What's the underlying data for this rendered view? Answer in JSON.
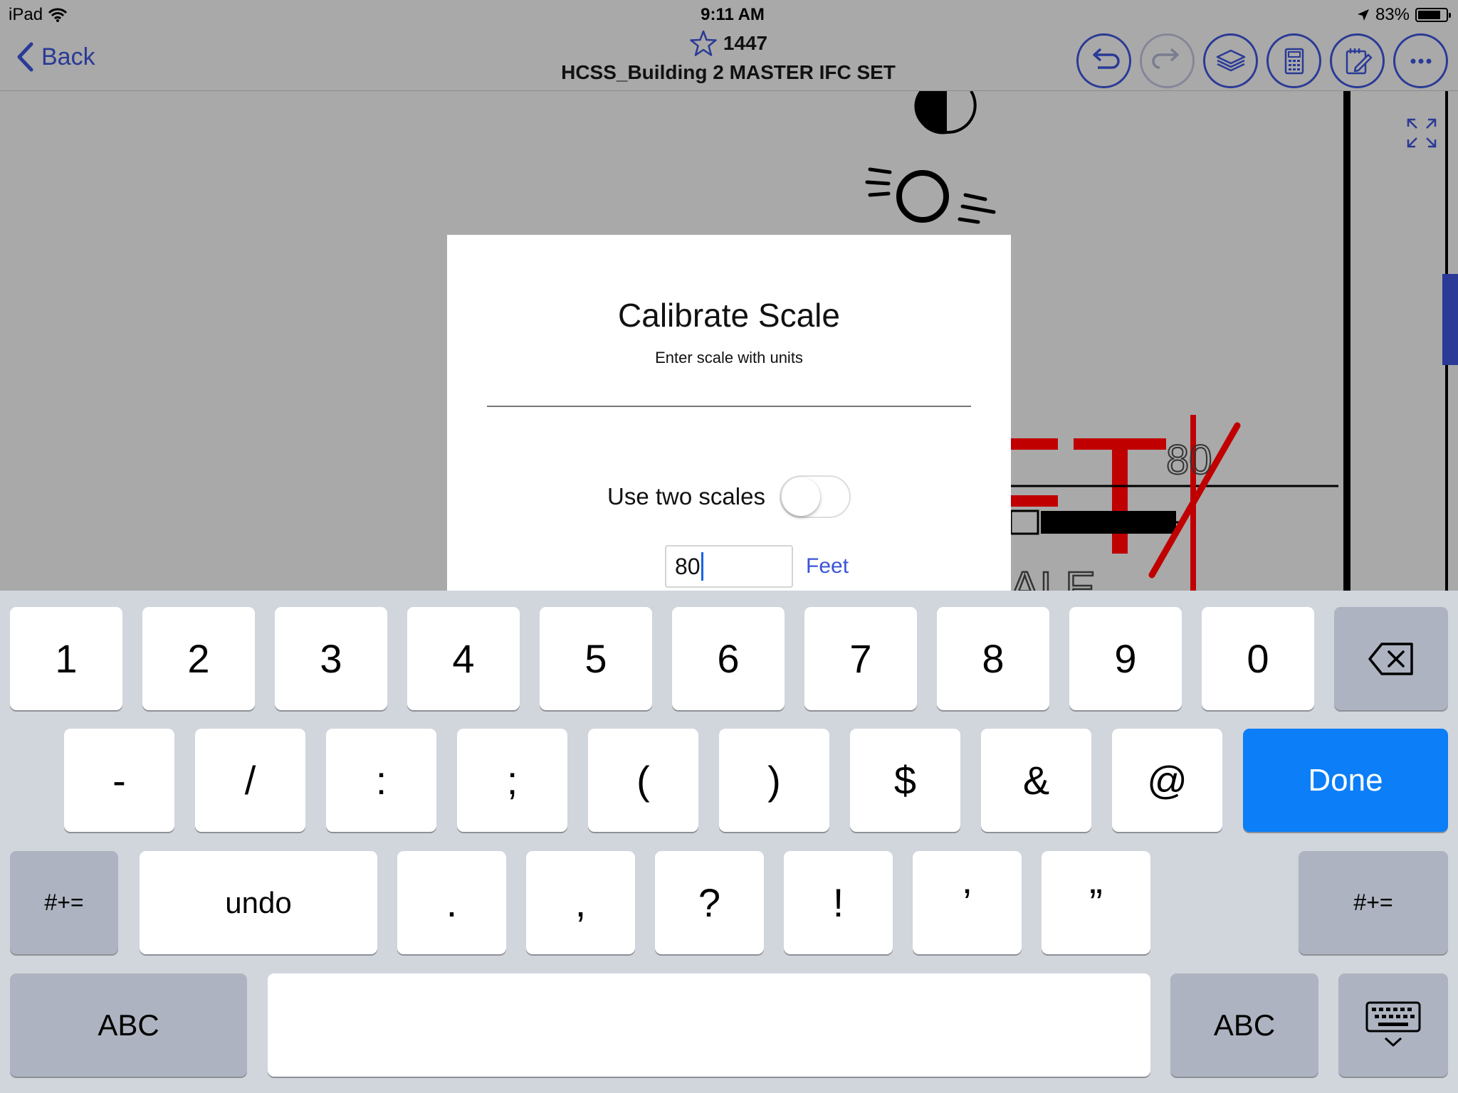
{
  "status_bar": {
    "device": "iPad",
    "time": "9:11 AM",
    "battery": "83%",
    "battery_level": 0.83
  },
  "nav": {
    "back_label": "Back",
    "sheet_number": "1447",
    "doc_title": "HCSS_Building 2 MASTER IFC SET",
    "tools": [
      "undo-icon",
      "redo-icon",
      "layers-icon",
      "calculator-icon",
      "notepad-icon",
      "more-icon"
    ]
  },
  "drawing": {
    "visible_text": [
      "T",
      "80",
      "ALE"
    ],
    "markup_color": "#c00000"
  },
  "dialog": {
    "title": "Calibrate Scale",
    "subtitle": "Enter scale with units",
    "two_scales_label": "Use two scales",
    "two_scales_on": false,
    "scale_value": "80",
    "unit_label": "Feet"
  },
  "keyboard": {
    "row1": [
      "1",
      "2",
      "3",
      "4",
      "5",
      "6",
      "7",
      "8",
      "9",
      "0"
    ],
    "row2": [
      "-",
      "/",
      ":",
      ";",
      "(",
      ")",
      "$",
      "&",
      "@"
    ],
    "done_label": "Done",
    "row3_toggle": "#+=",
    "undo_label": "undo",
    "row3": [
      ".",
      ",",
      "?",
      "!",
      "’",
      "”"
    ],
    "abc_label": "ABC",
    "accent": "#0b7ef8"
  }
}
